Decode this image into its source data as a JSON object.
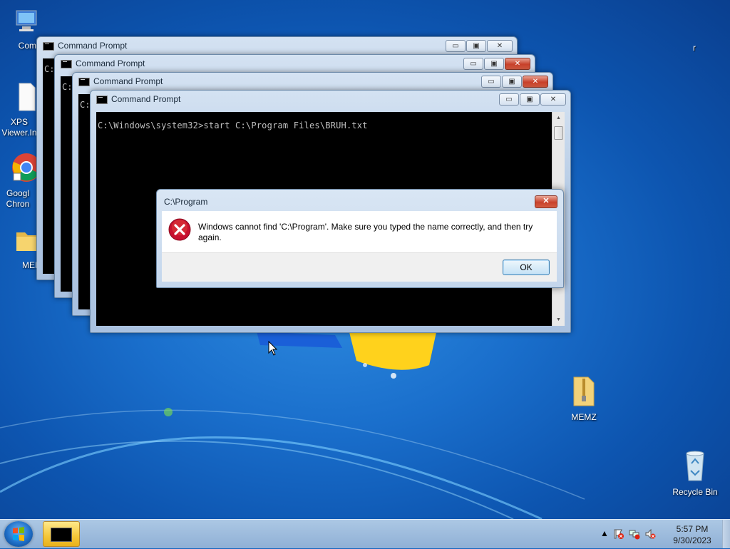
{
  "desktop": {
    "icons": [
      {
        "label": "Compu",
        "kind": "computer-icon"
      },
      {
        "label": "XPS Viewer.In",
        "kind": "document-icon"
      },
      {
        "label": "Googl Chron",
        "kind": "chrome-icon"
      },
      {
        "label": "MEM",
        "kind": "folder-icon"
      },
      {
        "label": "MEMZ",
        "kind": "zip-folder-icon"
      },
      {
        "label": "Recycle Bin",
        "kind": "recycle-bin-icon"
      }
    ],
    "stray_char": "r"
  },
  "windows": {
    "cmd_title": "Command Prompt",
    "peek_text": "C:",
    "command_line": "C:\\Windows\\system32>start C:\\Program Files\\BRUH.txt"
  },
  "controls": {
    "minimize": "▭",
    "maximize": "▣",
    "close": "✕"
  },
  "dialog": {
    "title": "C:\\Program",
    "message": "Windows cannot find 'C:\\Program'. Make sure you typed the name correctly, and then try again.",
    "ok_label": "OK",
    "close_glyph": "✕"
  },
  "taskbar": {
    "time": "5:57 PM",
    "date": "9/30/2023",
    "tray_icons": [
      "show-hidden-icons-icon",
      "action-center-icon",
      "network-icon",
      "volume-muted-icon"
    ]
  }
}
